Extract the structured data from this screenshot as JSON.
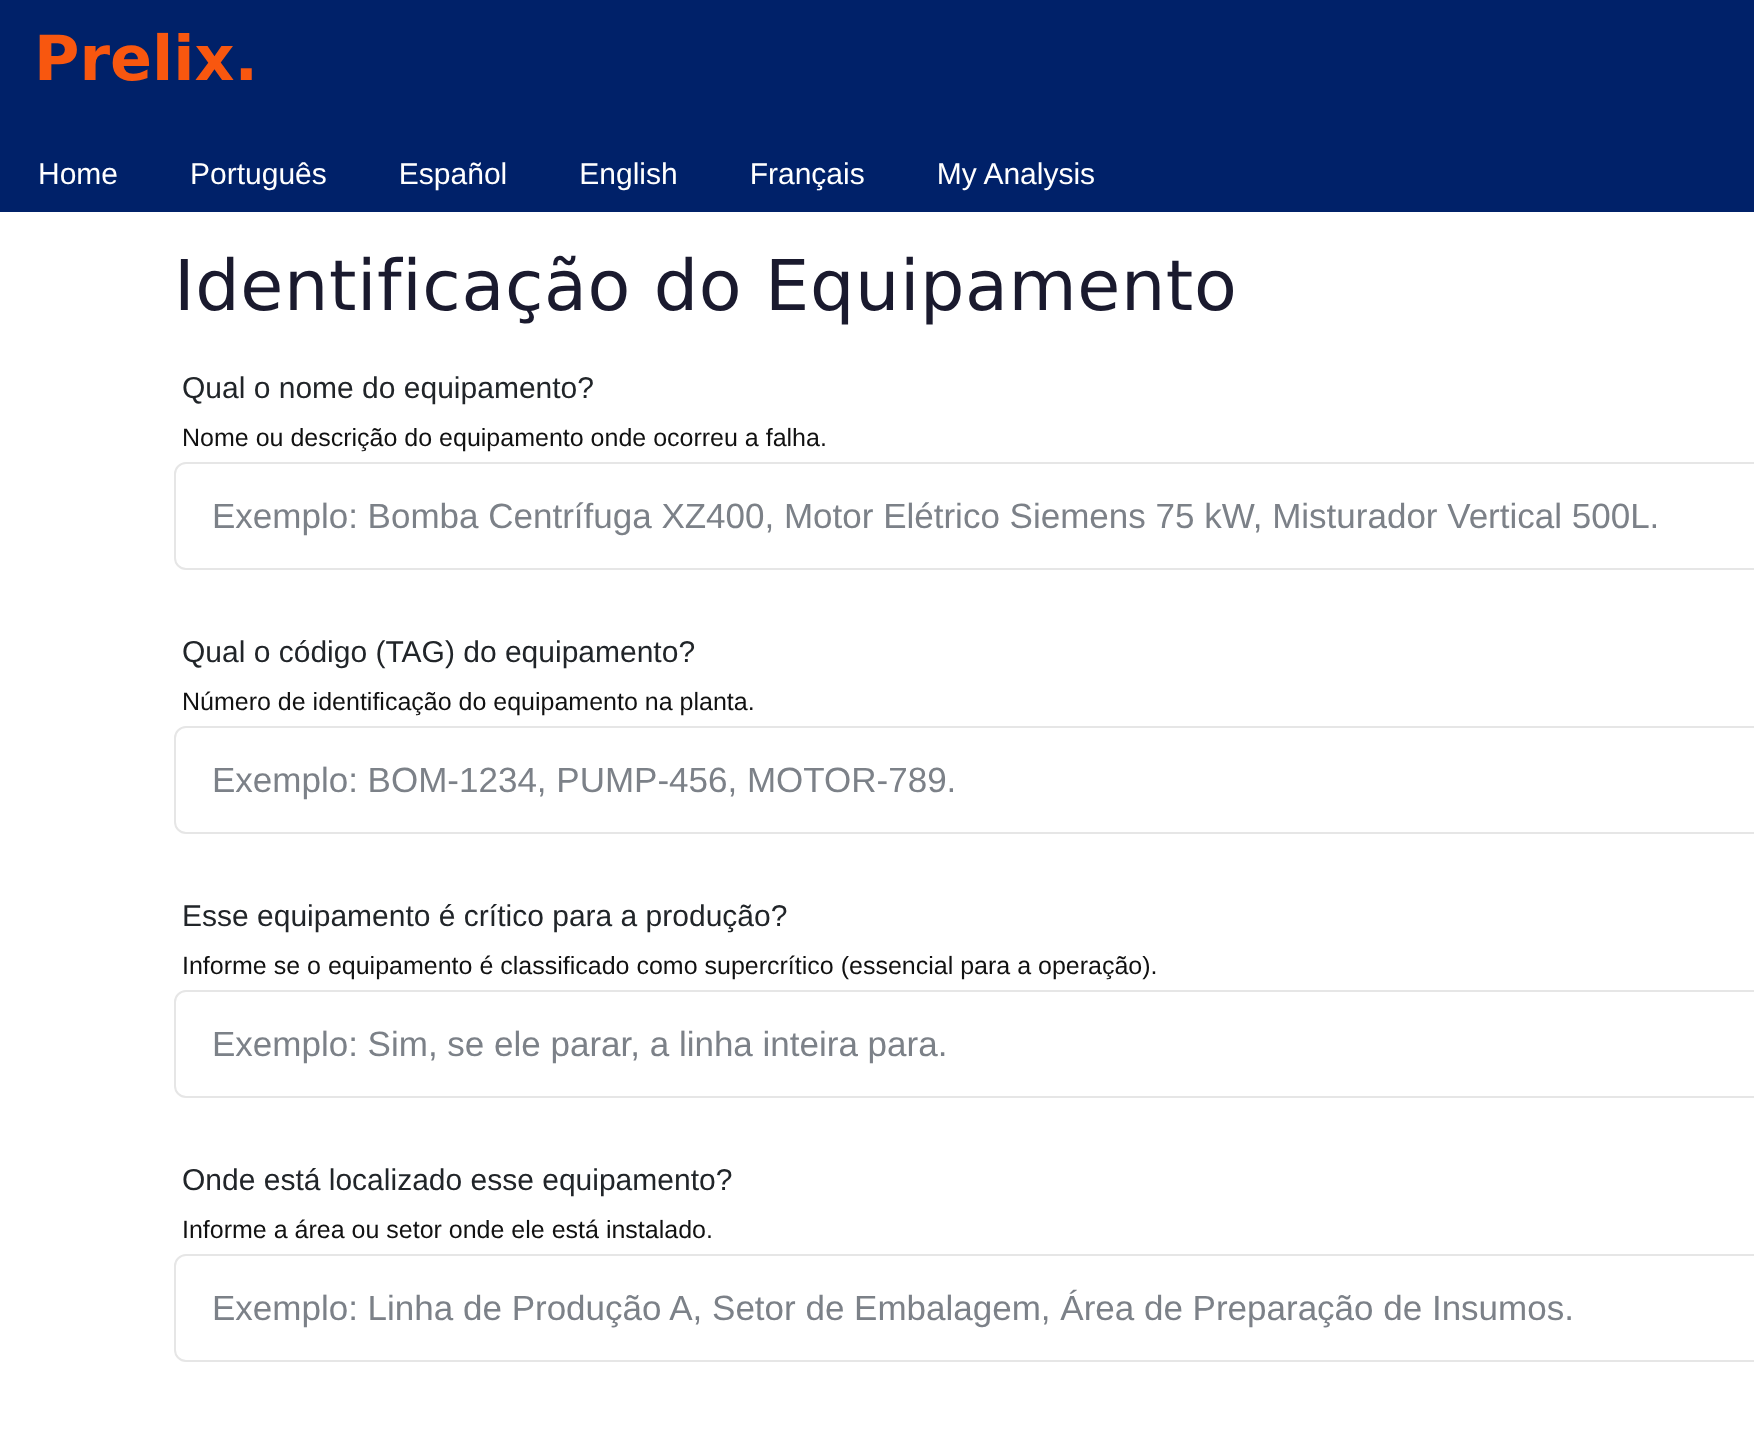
{
  "header": {
    "logo": "Prelix.",
    "nav": [
      {
        "label": "Home"
      },
      {
        "label": "Português"
      },
      {
        "label": "Español"
      },
      {
        "label": "English"
      },
      {
        "label": "Français"
      },
      {
        "label": "My Analysis"
      }
    ]
  },
  "page": {
    "title": "Identificação do Equipamento",
    "fields": [
      {
        "label": "Qual o nome do equipamento?",
        "hint": "Nome ou descrição do equipamento onde ocorreu a falha.",
        "placeholder": "Exemplo: Bomba Centrífuga XZ400, Motor Elétrico Siemens 75 kW, Misturador Vertical 500L."
      },
      {
        "label": "Qual o código (TAG) do equipamento?",
        "hint": "Número de identificação do equipamento na planta.",
        "placeholder": "Exemplo: BOM-1234, PUMP-456, MOTOR-789."
      },
      {
        "label": "Esse equipamento é crítico para a produção?",
        "hint": "Informe se o equipamento é classificado como supercrítico (essencial para a operação).",
        "placeholder": "Exemplo: Sim, se ele parar, a linha inteira para."
      },
      {
        "label": "Onde está localizado esse equipamento?",
        "hint": "Informe a área ou setor onde ele está instalado.",
        "placeholder": "Exemplo: Linha de Produção A, Setor de Embalagem, Área de Preparação de Insumos."
      }
    ]
  }
}
